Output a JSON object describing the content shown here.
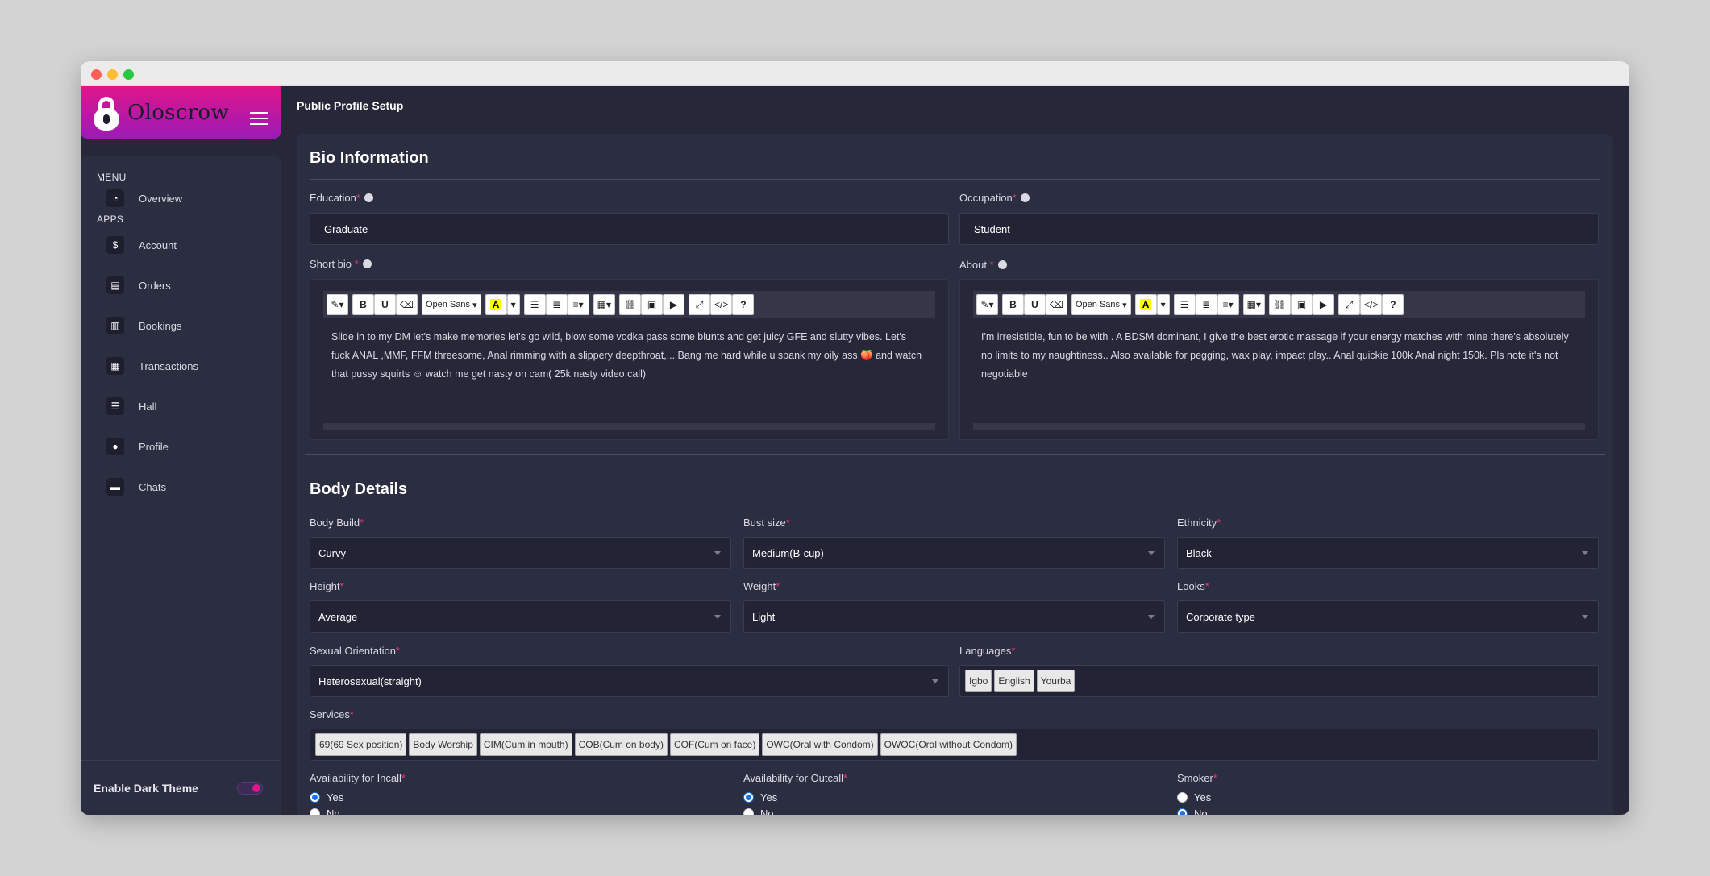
{
  "app": {
    "name": "Oloscrow"
  },
  "sidebar": {
    "menu_heading": "MENU",
    "apps_heading": "APPS",
    "items": [
      {
        "label": "Overview",
        "icon": "dashboard-icon"
      },
      {
        "label": "Account",
        "icon": "wallet-icon"
      },
      {
        "label": "Orders",
        "icon": "document-icon"
      },
      {
        "label": "Bookings",
        "icon": "book-icon"
      },
      {
        "label": "Transactions",
        "icon": "receipt-icon"
      },
      {
        "label": "Hall",
        "icon": "list-icon"
      },
      {
        "label": "Profile",
        "icon": "user-icon"
      },
      {
        "label": "Chats",
        "icon": "chat-icon"
      }
    ],
    "dark_theme_label": "Enable Dark Theme",
    "dark_theme_on": true
  },
  "header": {
    "title": "Public Profile Setup"
  },
  "bio": {
    "title": "Bio Information",
    "education_label": "Education",
    "education_value": "Graduate",
    "occupation_label": "Occupation",
    "occupation_value": "Student",
    "short_bio_label": "Short bio",
    "short_bio_text": "Slide in to my DM let's make memories let's go wild, blow some vodka pass some blunts and get juicy GFE and slutty vibes. Let's fuck ANAL ,MMF, FFM threesome, Anal rimming with a slippery deepthroat,... Bang me hard while u spank my oily ass 🍑 and watch that pussy squirts ☺ watch me get nasty on cam( 25k nasty video call)",
    "about_label": "About",
    "about_text": "I'm irresistible, fun to be with . A BDSM dominant, I give the best erotic massage if your energy matches with mine there's absolutely no limits to my naughtiness.. Also available for pegging, wax play, impact play.. Anal quickie 100k Anal night 150k. Pls note it's not negotiable",
    "font_name": "Open Sans"
  },
  "body": {
    "title": "Body Details",
    "build_label": "Body Build",
    "build_value": "Curvy",
    "bust_label": "Bust size",
    "bust_value": "Medium(B-cup)",
    "ethnicity_label": "Ethnicity",
    "ethnicity_value": "Black",
    "height_label": "Height",
    "height_value": "Average",
    "weight_label": "Weight",
    "weight_value": "Light",
    "looks_label": "Looks",
    "looks_value": "Corporate type",
    "orientation_label": "Sexual Orientation",
    "orientation_value": "Heterosexual(straight)",
    "languages_label": "Languages",
    "languages": [
      "Igbo",
      "English",
      "Yourba"
    ],
    "services_label": "Services",
    "services": [
      "69(69 Sex position)",
      "Body Worship",
      "CIM(Cum in mouth)",
      "COB(Cum on body)",
      "COF(Cum on face)",
      "OWC(Oral with Condom)",
      "OWOC(Oral without Condom)"
    ],
    "incall_label": "Availability for Incall",
    "outcall_label": "Availability for Outcall",
    "smoker_label": "Smoker",
    "yes": "Yes",
    "no": "No",
    "incall": "Yes",
    "outcall": "Yes",
    "smoker": "No"
  },
  "colors": {
    "brand_pink": "#e0148a",
    "brand_purple": "#9b1bb8",
    "background": "#262839",
    "required": "#e6397a",
    "radio_blue": "#1a73e8"
  }
}
